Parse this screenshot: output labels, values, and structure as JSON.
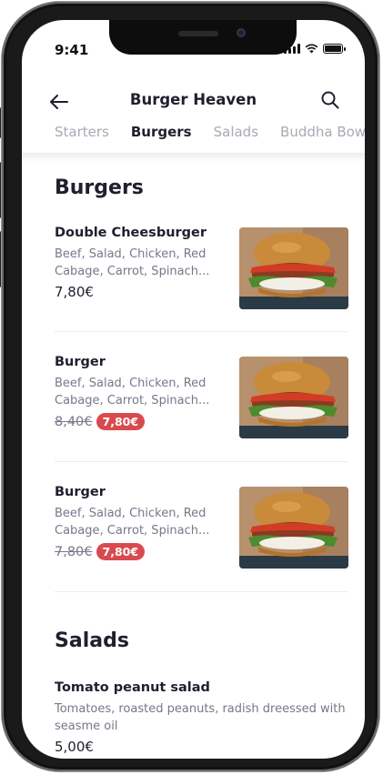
{
  "status_bar": {
    "time": "9:41"
  },
  "header": {
    "title": "Burger Heaven"
  },
  "tabs": [
    {
      "label": "Starters",
      "active": false
    },
    {
      "label": "Burgers",
      "active": true
    },
    {
      "label": "Salads",
      "active": false
    },
    {
      "label": "Buddha Bowls",
      "active": false
    }
  ],
  "sections": [
    {
      "title": "Burgers",
      "items": [
        {
          "name": "Double Cheesburger",
          "description": "Beef, Salad, Chicken, Red Cabage, Carrot, Spinach...",
          "price": "7,80€",
          "old_price": "",
          "sale_price": ""
        },
        {
          "name": "Burger",
          "description": "Beef, Salad, Chicken, Red Cabage, Carrot, Spinach...",
          "price": "",
          "old_price": "8,40€",
          "sale_price": "7,80€"
        },
        {
          "name": "Burger",
          "description": "Beef, Salad, Chicken, Red Cabage, Carrot, Spinach...",
          "price": "",
          "old_price": "7,80€",
          "sale_price": "7,80€"
        }
      ]
    },
    {
      "title": "Salads",
      "items": [
        {
          "name": "Tomato peanut salad",
          "description": "Tomatoes, roasted peanuts, radish dreessed with seasme oil",
          "price": "5,00€"
        }
      ]
    }
  ],
  "colors": {
    "accent": "#d94a4f",
    "text": "#1f1f2e",
    "muted": "#77778a",
    "tab_inactive": "#a9a9b4"
  },
  "icons": {
    "back": "arrow-left-icon",
    "search": "search-icon",
    "signal": "signal-icon",
    "wifi": "wifi-icon",
    "battery": "battery-icon"
  }
}
